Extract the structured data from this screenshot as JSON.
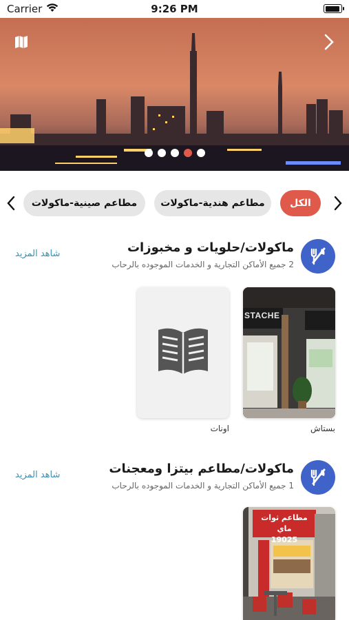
{
  "status": {
    "carrier": "Carrier",
    "time": "9:26 PM"
  },
  "hero": {
    "slide_count": 5,
    "active_slide": 4
  },
  "categories": [
    {
      "label": "الكل",
      "active": true
    },
    {
      "label": "مطاعم هندية-ماكولات",
      "active": false
    },
    {
      "label": "مطاعم صينية-ماكولات",
      "active": false
    }
  ],
  "sections": [
    {
      "title": "ماكولات/حلويات و مخبوزات",
      "subtitle": "2 جميع الأماكن التجارية و الخدمات الموجوده بالرحاب",
      "see_more": "شاهد المزيد",
      "items": [
        {
          "label": "بستاش",
          "sign": "STACHE"
        },
        {
          "label": "اونات"
        }
      ]
    },
    {
      "title": "ماكولات/مطاعم بيتزا ومعجنات",
      "subtitle": "1 جميع الأماكن التجارية و الخدمات الموجوده بالرحاب",
      "see_more": "شاهد المزيد",
      "items": [
        {
          "label": "",
          "sign_ar": "مطاعم ثوات ماي",
          "sign_num": "19025"
        }
      ]
    }
  ],
  "colors": {
    "accent": "#e05a4b",
    "icon_bg": "#3f63c8",
    "link": "#3a8fb2"
  }
}
